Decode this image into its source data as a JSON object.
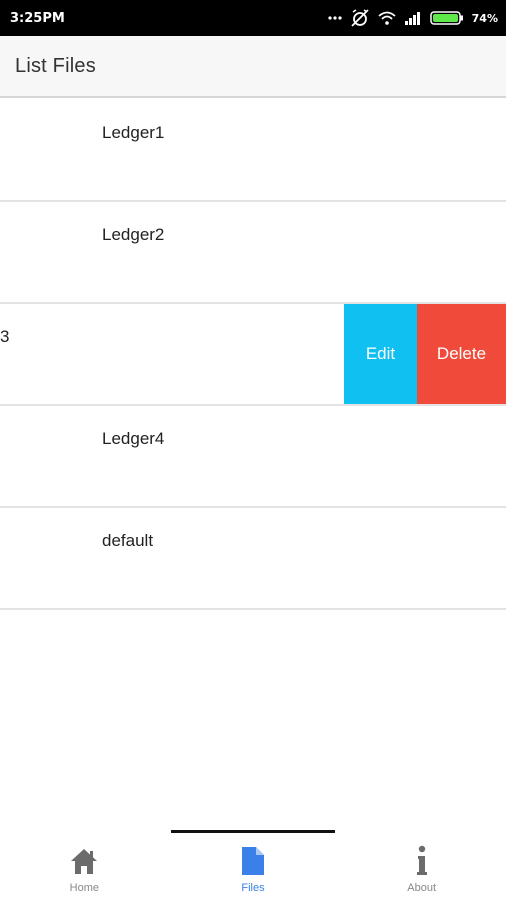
{
  "status_bar": {
    "time": "3:25PM",
    "battery": "74%",
    "icons": [
      "more-dots-icon",
      "alarm-off-icon",
      "wifi-icon",
      "signal-icon",
      "battery-icon"
    ]
  },
  "header": {
    "title": "List Files"
  },
  "files": [
    {
      "label": "Ledger1"
    },
    {
      "label": "Ledger2"
    },
    {
      "label": "3",
      "swiped": true
    },
    {
      "label": "Ledger4"
    },
    {
      "label": "default"
    }
  ],
  "row_actions": {
    "edit_label": "Edit",
    "delete_label": "Delete"
  },
  "tabs": [
    {
      "label": "Home",
      "icon": "home-icon",
      "active": false
    },
    {
      "label": "Files",
      "icon": "file-icon",
      "active": true
    },
    {
      "label": "About",
      "icon": "info-icon",
      "active": false
    }
  ],
  "colors": {
    "edit": "#0fc0f0",
    "delete": "#ef4a3a",
    "active_tab": "#3a80e8"
  }
}
